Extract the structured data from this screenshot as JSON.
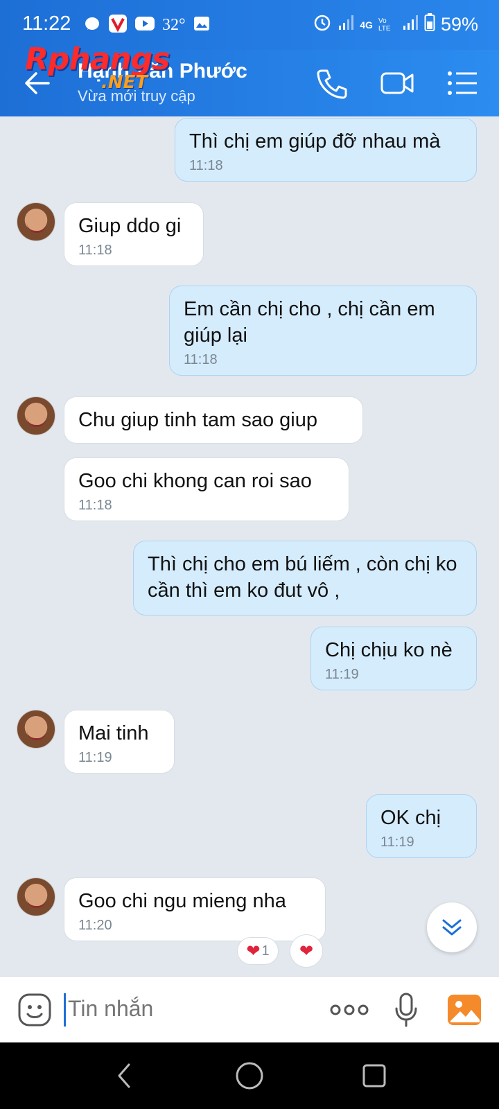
{
  "status_bar": {
    "time": "11:22",
    "temperature": "32°",
    "network_1": "4G",
    "network_2": "Vo LTE",
    "battery": "59%"
  },
  "header": {
    "contact_name": "Hạnh Văn Phước",
    "status": "Vừa mới truy cập",
    "watermark_main": "Rphangs",
    "watermark_sub": ".NET"
  },
  "messages": [
    {
      "dir": "out",
      "text": "Thì chị em giúp đỡ nhau mà",
      "time": "11:18"
    },
    {
      "dir": "in",
      "text": "Giup ddo gi",
      "time": "11:18"
    },
    {
      "dir": "out",
      "text": "Em cần chị cho , chị cần em giúp lại",
      "time": "11:18"
    },
    {
      "dir": "in",
      "text": " Chu giup tinh tam sao giup",
      "time": ""
    },
    {
      "dir": "in",
      "text": "Goo chi khong can roi sao",
      "time": "11:18"
    },
    {
      "dir": "out",
      "text": "Thì chị cho em bú liếm , còn chị ko cần thì em ko đut vô ,",
      "time": ""
    },
    {
      "dir": "out",
      "text": "Chị chịu ko nè",
      "time": "11:19"
    },
    {
      "dir": "in",
      "text": "Mai tinh",
      "time": "11:19"
    },
    {
      "dir": "out",
      "text": "OK chị",
      "time": "11:19"
    },
    {
      "dir": "in",
      "text": " Goo chi ngu mieng nha",
      "time": "11:20"
    }
  ],
  "reaction": {
    "count": "1"
  },
  "composer": {
    "placeholder": "Tin nhắn"
  },
  "colors": {
    "header": "#1d6fd6",
    "outgoing_bubble": "#d5ecfd",
    "incoming_bubble": "#ffffff",
    "background": "#e3e8ef"
  }
}
